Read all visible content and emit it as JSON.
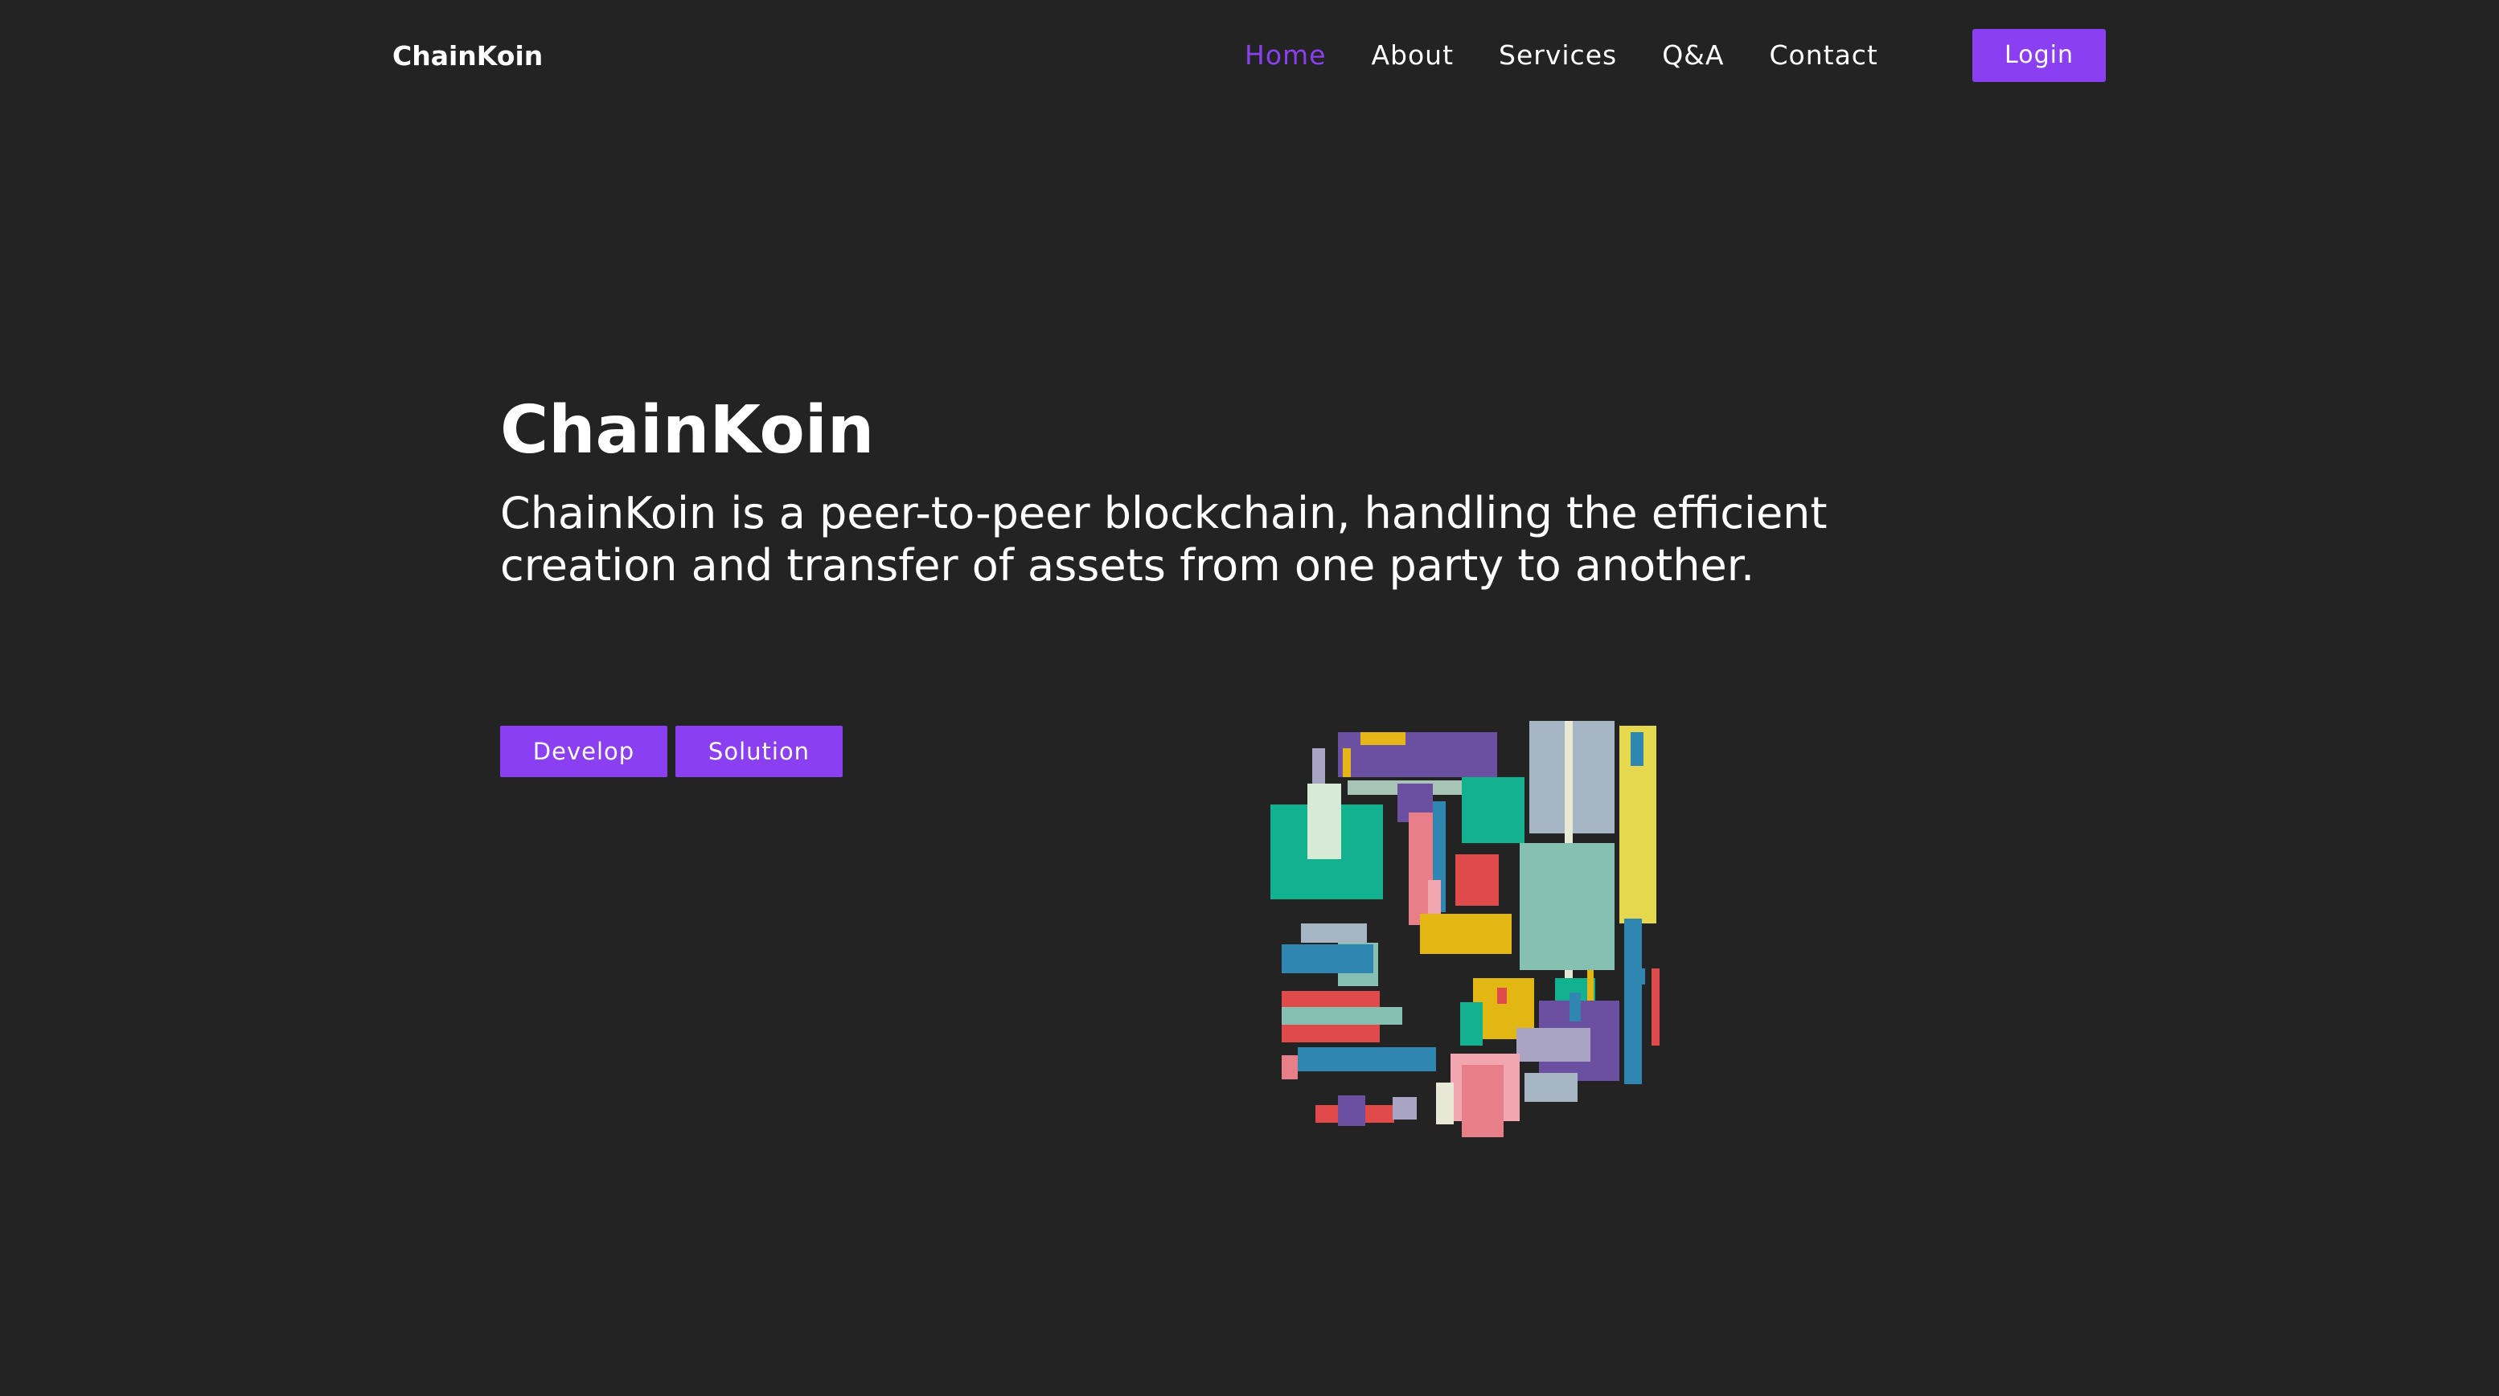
{
  "nav": {
    "brand": "ChainKoin",
    "links": [
      {
        "label": "Home",
        "active": true
      },
      {
        "label": "About",
        "active": false
      },
      {
        "label": "Services",
        "active": false
      },
      {
        "label": "Q&A",
        "active": false
      },
      {
        "label": "Contact",
        "active": false
      }
    ],
    "login_label": "Login"
  },
  "hero": {
    "title": "ChainKoin",
    "description": "ChainKoin is a peer-to-peer blockchain, handling the efficient creation and transfer of assets from one party to another.",
    "buttons": {
      "develop_label": "Develop",
      "solution_label": "Solution"
    }
  },
  "illustration": {
    "icon": "abstract-blocks-illustration"
  },
  "colors": {
    "background": "#232323",
    "accent": "#8a3ff0",
    "text": "#ffffff"
  }
}
